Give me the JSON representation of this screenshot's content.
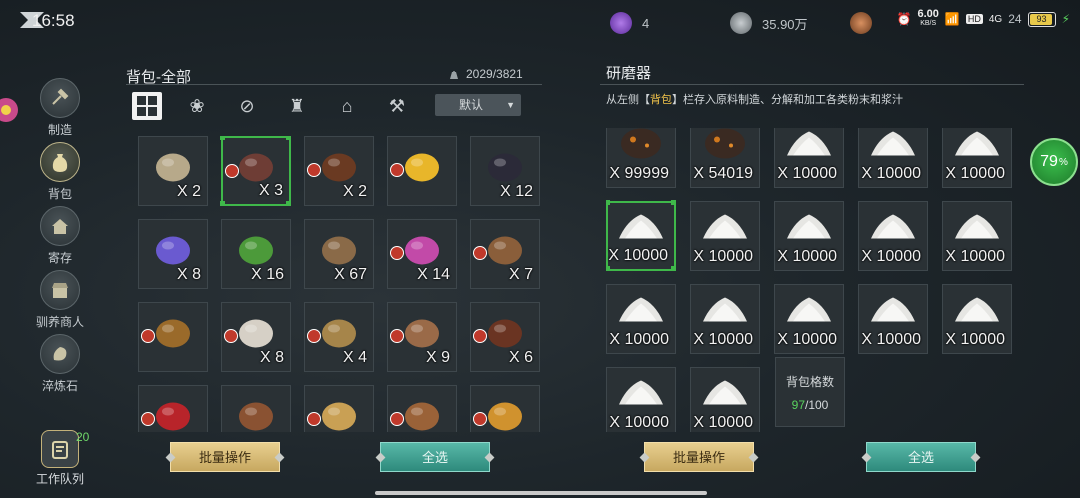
{
  "status": {
    "time": "16:58",
    "resources": [
      {
        "icon": "purple-gem-icon",
        "value": "4",
        "color": "#8a4bd0"
      },
      {
        "icon": "silver-coin-icon",
        "value": "35.90万",
        "color": "#9aa2a6"
      },
      {
        "icon": "copper-coin-icon",
        "value": "24",
        "color": "#b07040"
      }
    ],
    "net_speed": "6.00",
    "net_unit": "KB/S",
    "battery": "93"
  },
  "nav": {
    "items": [
      {
        "label": "制造",
        "icon": "hammer-icon",
        "active": false
      },
      {
        "label": "背包",
        "icon": "bag-icon",
        "active": true
      },
      {
        "label": "寄存",
        "icon": "house-icon",
        "active": false
      },
      {
        "label": "驯养商人",
        "icon": "shop-icon",
        "active": false
      },
      {
        "label": "淬炼石",
        "icon": "stone-icon",
        "active": false
      }
    ],
    "work_queue": {
      "label": "工作队列",
      "count": "20"
    }
  },
  "backpack": {
    "title": "背包-全部",
    "capacity": "2029/3821",
    "sort_label": "默认",
    "filters": [
      "all-filter-icon",
      "materials-filter-icon",
      "food-filter-icon",
      "potion-filter-icon",
      "building-filter-icon",
      "tool-filter-icon"
    ],
    "items": [
      {
        "name": "rope",
        "qty": "X 2",
        "badge": false,
        "color": "#b7a98a"
      },
      {
        "name": "cocoa-beans",
        "qty": "X 3",
        "badge": true,
        "color": "#6e3d35",
        "selected": true
      },
      {
        "name": "pine-cone",
        "qty": "X 2",
        "badge": true,
        "color": "#6a3a22"
      },
      {
        "name": "citrus",
        "qty": "",
        "badge": true,
        "color": "#e8b62a"
      },
      {
        "name": "blackberry",
        "qty": "X 12",
        "badge": false,
        "color": "#2b2a38"
      },
      {
        "name": "purple-seed",
        "qty": "X 8",
        "badge": false,
        "color": "#6a5ad0"
      },
      {
        "name": "herb-leaves",
        "qty": "X 16",
        "badge": false,
        "color": "#4c9a3a"
      },
      {
        "name": "logs",
        "qty": "X 67",
        "badge": false,
        "color": "#8a6a48"
      },
      {
        "name": "orchid",
        "qty": "X 14",
        "badge": true,
        "color": "#c24aa8"
      },
      {
        "name": "pine-cone-brown",
        "qty": "X 7",
        "badge": true,
        "color": "#8a5e3a"
      },
      {
        "name": "nuts",
        "qty": "",
        "badge": true,
        "color": "#9a6a2a"
      },
      {
        "name": "white-mushroom",
        "qty": "X 8",
        "badge": true,
        "color": "#d6d0c6"
      },
      {
        "name": "root",
        "qty": "X 4",
        "badge": true,
        "color": "#a6854a"
      },
      {
        "name": "brown-mushrooms",
        "qty": "X 9",
        "badge": true,
        "color": "#9a6a48"
      },
      {
        "name": "chestnuts",
        "qty": "X 6",
        "badge": true,
        "color": "#6a3422"
      },
      {
        "name": "cherries",
        "qty": "",
        "badge": true,
        "color": "#b8242a"
      },
      {
        "name": "acorn",
        "qty": "",
        "badge": false,
        "color": "#8a5232"
      },
      {
        "name": "wheat",
        "qty": "",
        "badge": true,
        "color": "#c9a054"
      },
      {
        "name": "porcini",
        "qty": "",
        "badge": true,
        "color": "#9a6238"
      },
      {
        "name": "grains",
        "qty": "",
        "badge": true,
        "color": "#d0922e"
      }
    ],
    "batch_button": "批量操作",
    "select_all_button": "全选"
  },
  "grinder": {
    "title": "研磨器",
    "desc_prefix": "从左侧【",
    "desc_highlight": "背包",
    "desc_suffix": "】栏存入原料制造、分解和加工各类粉末和浆汁",
    "progress_value": "79",
    "progress_unit": "%",
    "items": [
      {
        "qty": "X 99999",
        "kind": "dark-ore",
        "color": "#3a2a22"
      },
      {
        "qty": "X 54019",
        "kind": "dark-ore",
        "color": "#3a2a22"
      },
      {
        "qty": "X 10000",
        "kind": "powder"
      },
      {
        "qty": "X 10000",
        "kind": "powder"
      },
      {
        "qty": "X 10000",
        "kind": "powder"
      },
      {
        "qty": "X 10000",
        "kind": "powder",
        "selected": true
      },
      {
        "qty": "X 10000",
        "kind": "powder"
      },
      {
        "qty": "X 10000",
        "kind": "powder"
      },
      {
        "qty": "X 10000",
        "kind": "powder"
      },
      {
        "qty": "X 10000",
        "kind": "powder"
      },
      {
        "qty": "X 10000",
        "kind": "powder"
      },
      {
        "qty": "X 10000",
        "kind": "powder"
      },
      {
        "qty": "X 10000",
        "kind": "powder"
      },
      {
        "qty": "X 10000",
        "kind": "powder"
      },
      {
        "qty": "X 10000",
        "kind": "powder"
      },
      {
        "qty": "X 10000",
        "kind": "powder"
      },
      {
        "qty": "X 10000",
        "kind": "powder"
      }
    ],
    "slots_label": "背包格数",
    "slots_used": "97",
    "slots_total": "/100",
    "batch_button": "批量操作",
    "select_all_button": "全选"
  }
}
